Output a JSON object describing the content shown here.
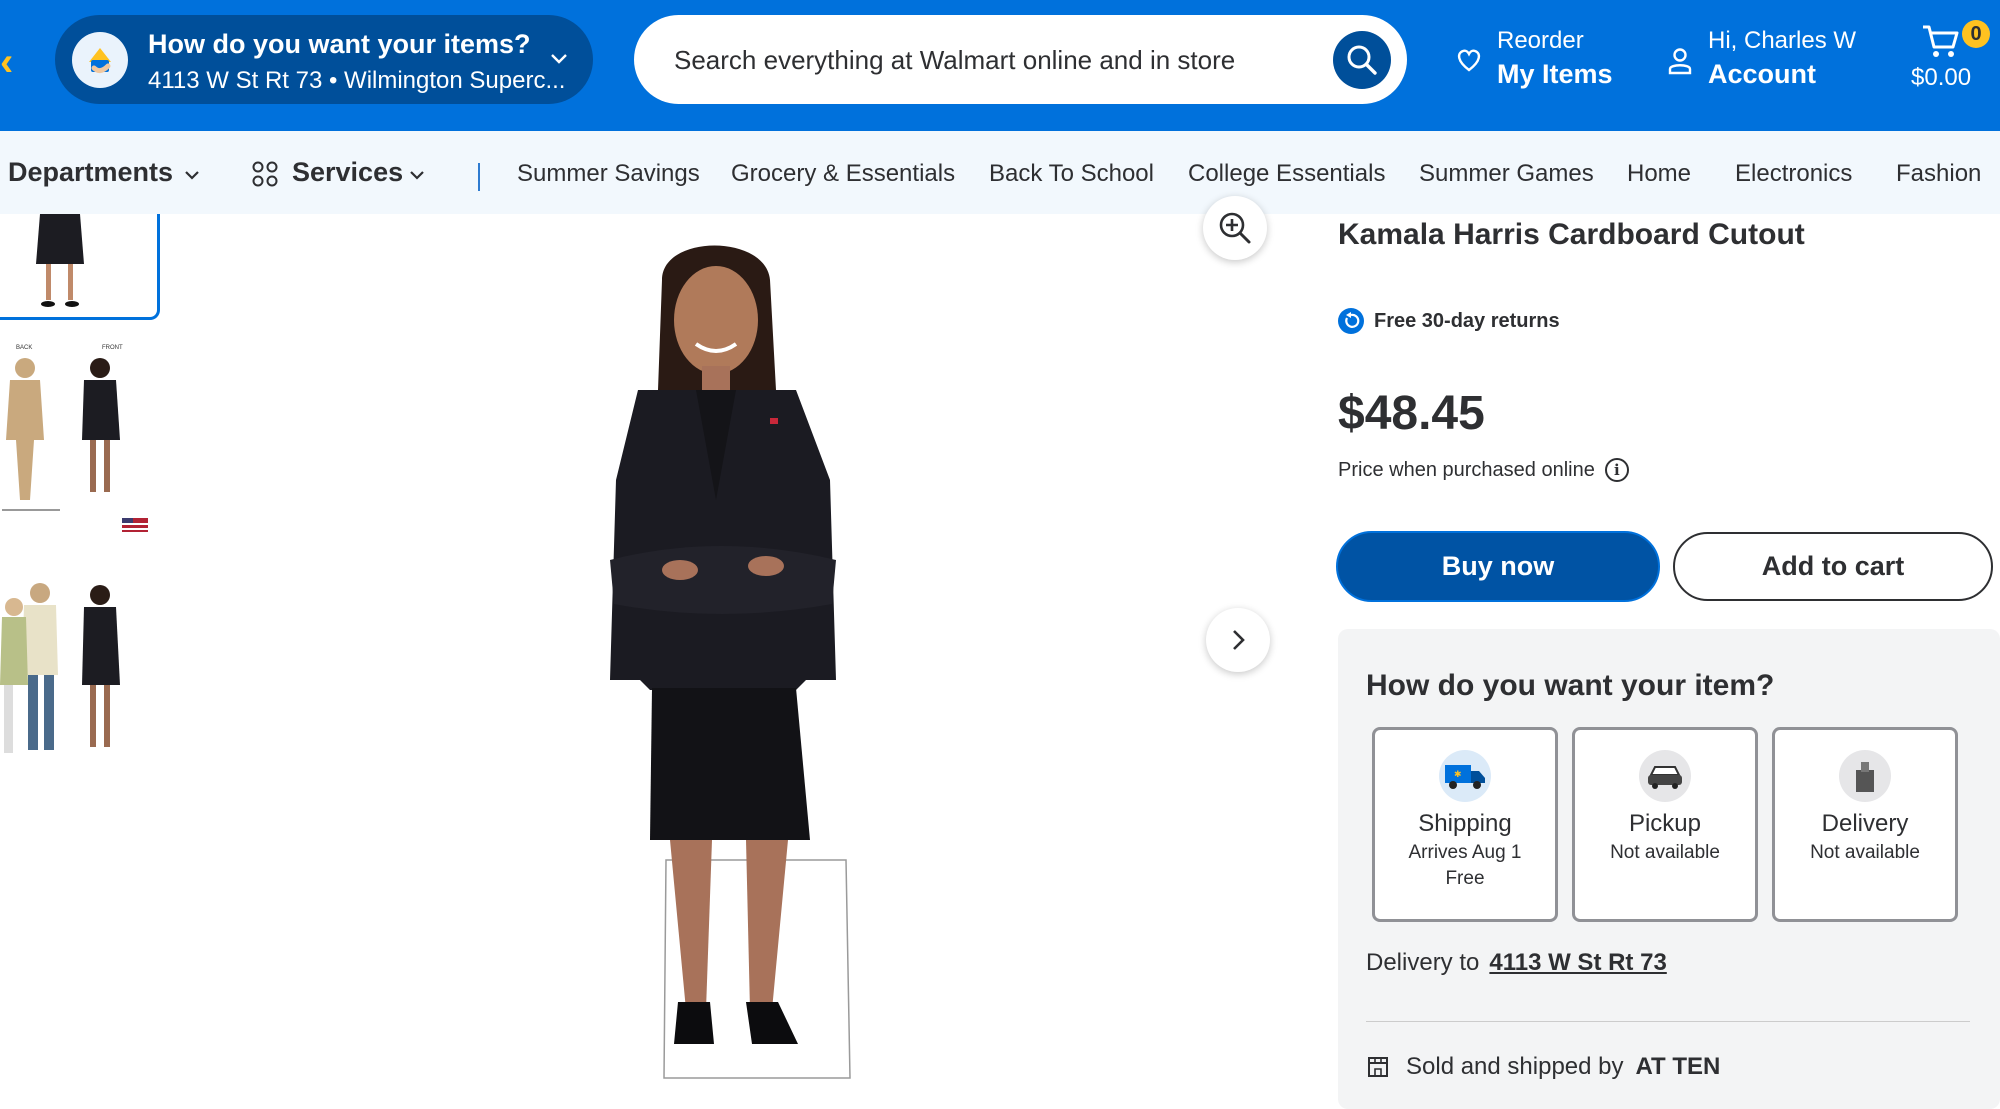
{
  "header": {
    "location_title": "How do you want your items?",
    "location_sub": "4113 W St Rt 73 • Wilmington Superc...",
    "search_placeholder": "Search everything at Walmart online and in store",
    "reorder_l1": "Reorder",
    "reorder_l2": "My Items",
    "account_l1": "Hi, Charles W",
    "account_l2": "Account",
    "cart_count": "0",
    "cart_total": "$0.00",
    "brand_color": "#0071dc",
    "accent_color": "#ffc220"
  },
  "nav": {
    "departments": "Departments",
    "services": "Services",
    "links": [
      "Summer Savings",
      "Grocery & Essentials",
      "Back To School",
      "College Essentials",
      "Summer Games",
      "Home",
      "Electronics",
      "Fashion"
    ]
  },
  "thumbs": {
    "back_label": "BACK",
    "front_label": "FRONT"
  },
  "product": {
    "title": "Kamala Harris Cardboard Cutout",
    "returns": "Free 30-day returns",
    "price": "$48.45",
    "price_note": "Price when purchased online",
    "buy_now": "Buy now",
    "add_to_cart": "Add to cart"
  },
  "fulfillment": {
    "title": "How do you want your item?",
    "options": [
      {
        "name": "Shipping",
        "line1": "Arrives Aug 1",
        "line2": "Free",
        "icon": "truck-icon"
      },
      {
        "name": "Pickup",
        "line1": "Not available",
        "line2": "",
        "icon": "car-icon"
      },
      {
        "name": "Delivery",
        "line1": "Not available",
        "line2": "",
        "icon": "bag-icon"
      }
    ],
    "delivery_label": "Delivery to",
    "delivery_address": "4113 W St Rt 73",
    "sold_label": "Sold and shipped by",
    "seller": "AT TEN"
  }
}
